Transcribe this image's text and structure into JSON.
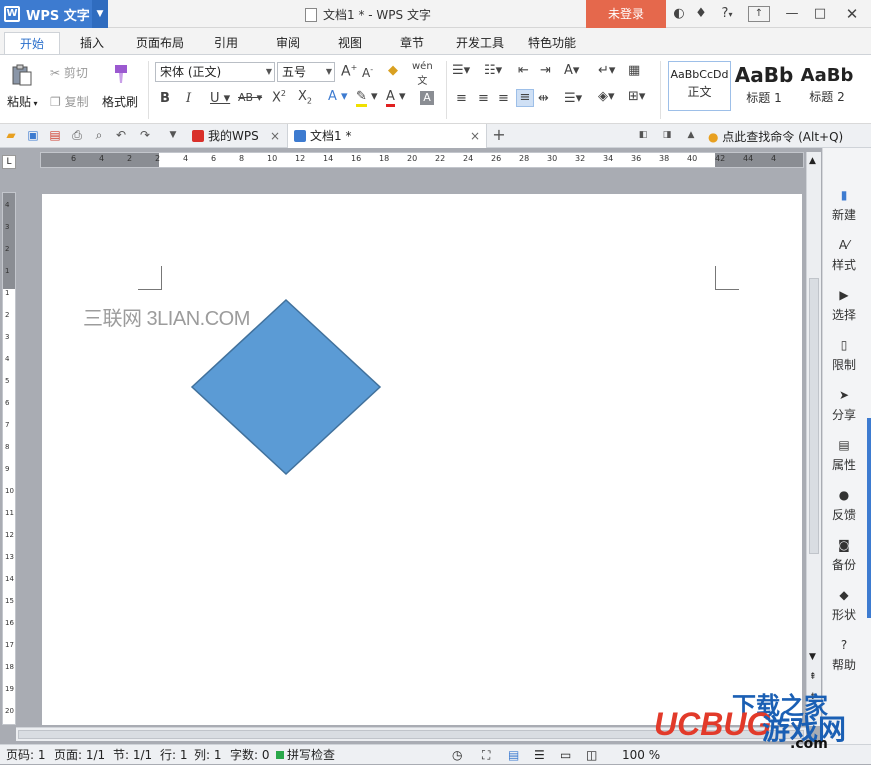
{
  "titlebar": {
    "app_name": "WPS 文字",
    "doc_title": "文档1 * - WPS 文字",
    "login": "未登录",
    "help": "?"
  },
  "menu": {
    "tabs": [
      "开始",
      "插入",
      "页面布局",
      "引用",
      "审阅",
      "视图",
      "章节",
      "开发工具",
      "特色功能"
    ]
  },
  "ribbon": {
    "paste": "粘贴",
    "cut": "剪切",
    "copy": "复制",
    "format_painter": "格式刷",
    "font_name": "宋体 (正文)",
    "font_size": "五号",
    "styles": [
      {
        "sample": "AaBbCcDd",
        "name": "正文"
      },
      {
        "sample": "AaBb",
        "name": "标题 1"
      },
      {
        "sample": "AaBb",
        "name": "标题 2"
      }
    ]
  },
  "tabstrip": {
    "tabs": [
      {
        "label": "我的WPS"
      },
      {
        "label": "文档1 *"
      }
    ],
    "add": "+",
    "search": "点此查找命令 (Alt+Q)"
  },
  "ruler": {
    "h_ticks": [
      "6",
      "4",
      "2",
      "2",
      "4",
      "6",
      "8",
      "10",
      "12",
      "14",
      "16",
      "18",
      "20",
      "22",
      "24",
      "26",
      "28",
      "30",
      "32",
      "34",
      "36",
      "38",
      "40",
      "42",
      "44",
      "4"
    ],
    "v_ticks": [
      "4",
      "3",
      "2",
      "1",
      "1",
      "2",
      "3",
      "4",
      "5",
      "6",
      "7",
      "8",
      "9",
      "10",
      "11",
      "12",
      "13",
      "14",
      "15",
      "16",
      "17",
      "18",
      "19",
      "20"
    ]
  },
  "document": {
    "watermark": "三联网 3LIAN.COM",
    "shape_color": "#5b9bd5",
    "shape_border": "#41719c"
  },
  "sidepanel": {
    "items": [
      "新建",
      "样式",
      "选择",
      "限制",
      "分享",
      "属性",
      "反馈",
      "备份",
      "形状",
      "帮助"
    ]
  },
  "status": {
    "page_num": "页码: 1",
    "pages": "页面: 1/1",
    "section": "节: 1/1",
    "row": "行: 1",
    "col": "列: 1",
    "words": "字数: 0",
    "spell": "拼写检查",
    "zoom": "100 %"
  },
  "overlay": {
    "top": "下载之家",
    "brand": "UCBUG",
    "game": "游戏网",
    "com": ".com"
  }
}
